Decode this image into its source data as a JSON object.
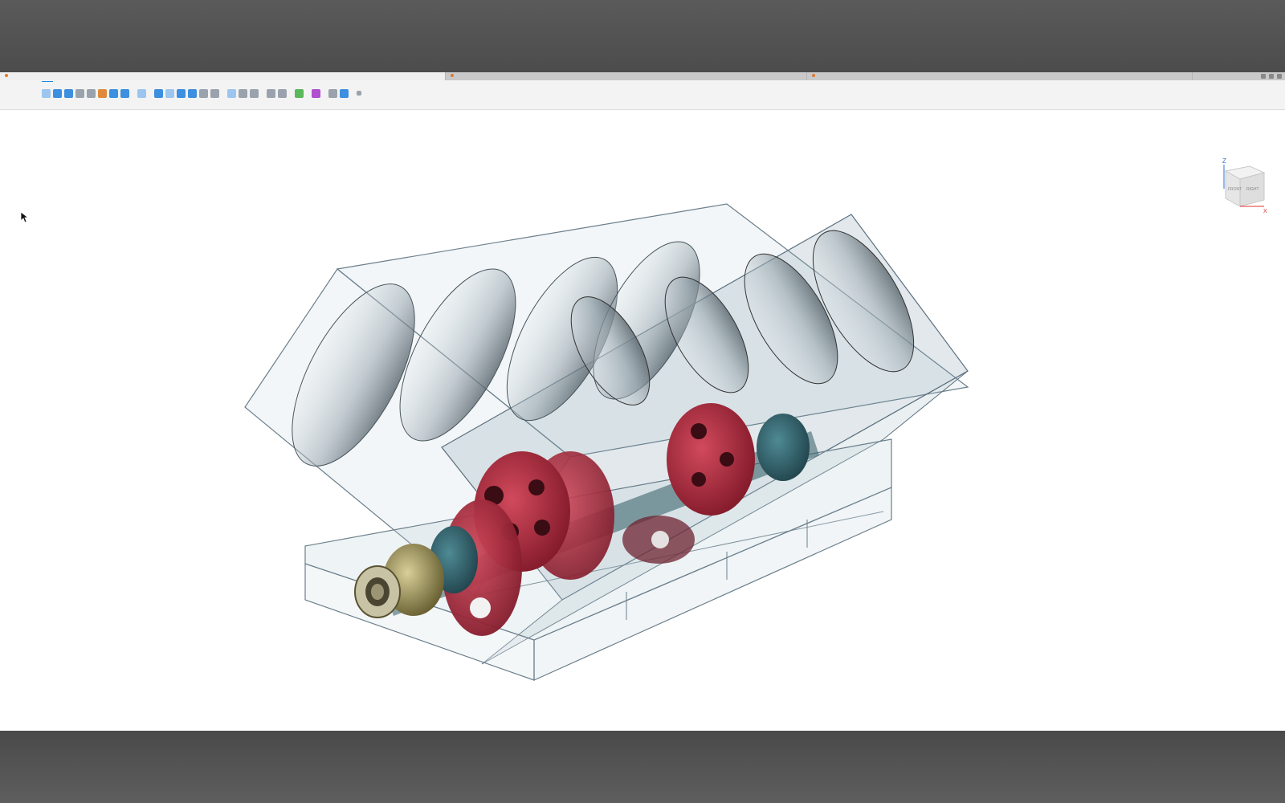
{
  "app": {
    "tabs": [
      {
        "label": "",
        "active": true
      },
      {
        "label": "",
        "active": false
      },
      {
        "label": "",
        "active": false
      }
    ]
  },
  "toolbar": {
    "workspace": "",
    "ribbon_tabs": [
      {
        "label": "",
        "active": true
      },
      {
        "label": "",
        "active": false
      },
      {
        "label": "",
        "active": false
      },
      {
        "label": "",
        "active": false
      },
      {
        "label": "",
        "active": false
      },
      {
        "label": "",
        "active": false
      },
      {
        "label": "",
        "active": false
      }
    ],
    "groups": [
      {
        "label": "",
        "icons": [
          "sketch-icon",
          "extrude-icon",
          "revolve-icon",
          "sweep-icon",
          "loft-icon",
          "hole-icon",
          "pattern-icon",
          "box-icon"
        ]
      },
      {
        "label": "",
        "icons": [
          "automate-icon"
        ]
      },
      {
        "label": "",
        "icons": [
          "press-pull-icon",
          "fillet-icon",
          "chamfer-icon",
          "shell-icon",
          "move-icon",
          "scale-icon"
        ]
      },
      {
        "label": "",
        "icons": [
          "joint-icon",
          "as-built-joint-icon",
          "rigid-group-icon"
        ]
      },
      {
        "label": "",
        "icons": [
          "measure-icon",
          "section-icon"
        ]
      },
      {
        "label": "",
        "icons": [
          "insert-icon"
        ]
      },
      {
        "label": "",
        "icons": [
          "select-icon"
        ]
      },
      {
        "label": "",
        "icons": [
          "inspect-icon",
          "display-icon"
        ]
      },
      {
        "label": "",
        "icons": [
          "more-icon"
        ]
      }
    ]
  },
  "viewcube": {
    "axis_z": "Z",
    "axis_x": "X",
    "face_front": "FRONT",
    "face_right": "RIGHT"
  },
  "colors": {
    "accent": "#1e88e5",
    "crank": "#b0243a",
    "housing_edge": "#5b6f7f",
    "background": "#ffffff"
  }
}
